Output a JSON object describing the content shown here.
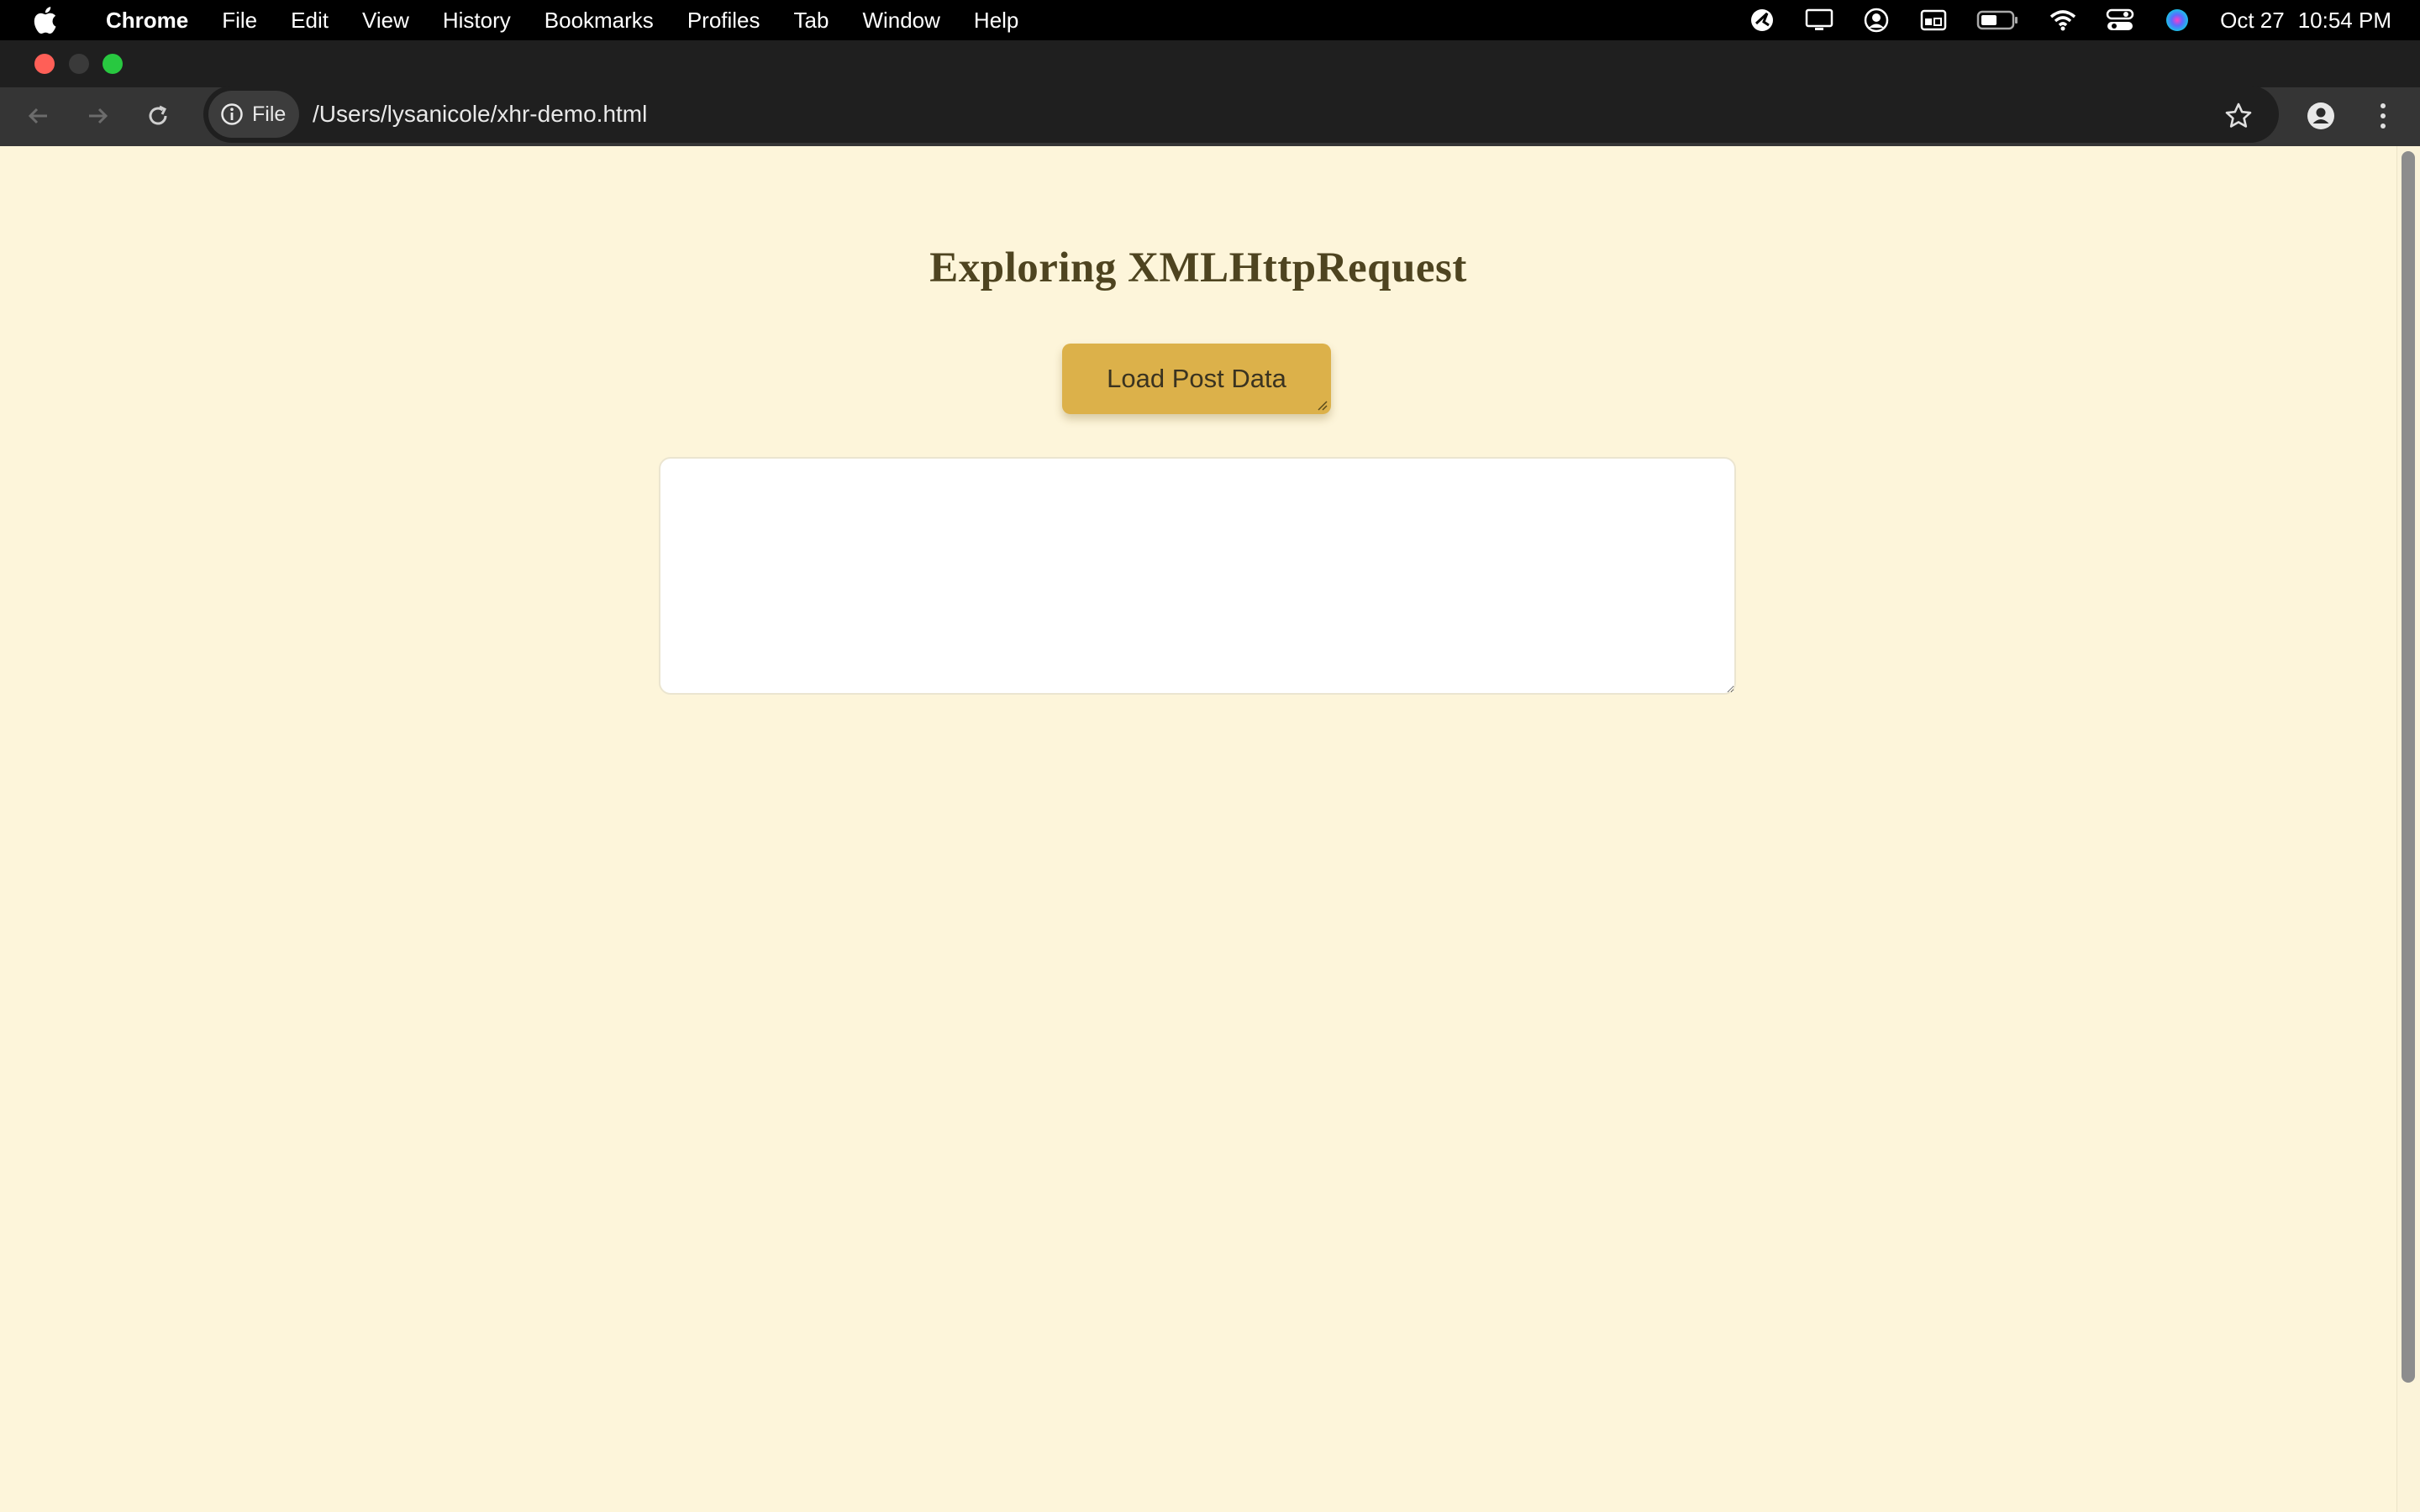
{
  "menubar": {
    "app_name": "Chrome",
    "items": [
      "File",
      "Edit",
      "View",
      "History",
      "Bookmarks",
      "Profiles",
      "Tab",
      "Window",
      "Help"
    ],
    "status_icons": [
      "vpn-icon",
      "display-icon",
      "user-circle-icon",
      "keyboard-input-icon",
      "battery-icon",
      "wifi-icon",
      "control-center-icon",
      "siri-icon"
    ],
    "date": "Oct 27",
    "time": "10:54 PM"
  },
  "browser": {
    "chip_label": "File",
    "url": "/Users/lysanicole/xhr-demo.html"
  },
  "page": {
    "title": "Exploring XMLHttpRequest",
    "button_label": "Load Post Data",
    "output_value": ""
  },
  "colors": {
    "background": "#fdf5da",
    "title": "#4e4420",
    "button": "#dcb14a",
    "button_text": "#3a3320"
  }
}
